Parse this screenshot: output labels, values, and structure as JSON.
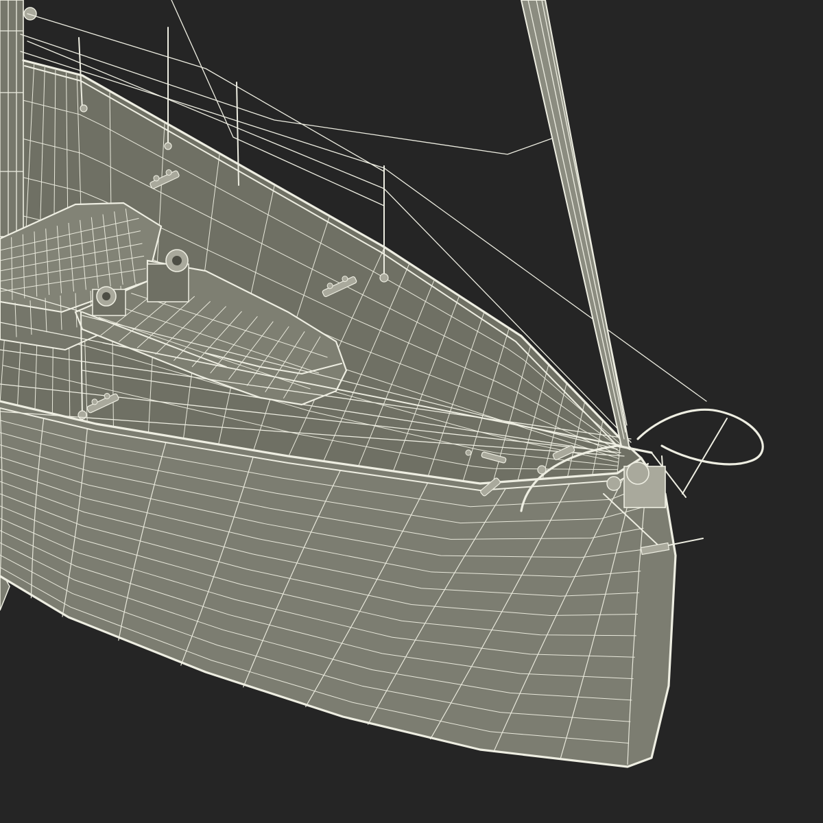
{
  "scene": {
    "subject": "sailboat-bow-wireframe",
    "colors": {
      "background": "#252525",
      "hull_fill": "#7c7d71",
      "deck_fill": "#6f7064",
      "hatch_fill": "#828376",
      "wire": "#eeeee2",
      "hardware_fill": "#a9a99c"
    }
  }
}
